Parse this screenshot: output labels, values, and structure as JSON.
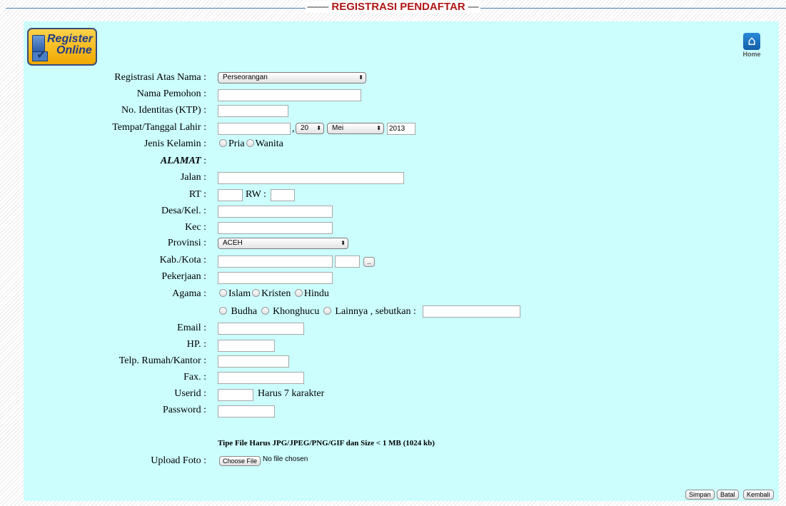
{
  "header": {
    "title": "REGISTRASI PENDAFTAR"
  },
  "logo": {
    "line1": "Register",
    "line2": "Online"
  },
  "home": {
    "label": "Home"
  },
  "labels": {
    "registrasi": "Registrasi Atas Nama :",
    "nama": "Nama Pemohon :",
    "identitas": "No. Identitas (KTP) :",
    "ttl": "Tempat/Tanggal Lahir :",
    "kelamin": "Jenis Kelamin :",
    "alamat": "ALAMAT",
    "alamat_colon": ":",
    "jalan": "Jalan :",
    "rt": "RT :",
    "rw": "RW :",
    "desa": "Desa/Kel. :",
    "kec": "Kec :",
    "provinsi": "Provinsi :",
    "kab": "Kab./Kota :",
    "pekerjaan": "Pekerjaan :",
    "agama": "Agama :",
    "email": "Email :",
    "hp": "HP. :",
    "telp": "Telp. Rumah/Kantor :",
    "fax": "Fax. :",
    "userid": "Userid :",
    "password": "Password :",
    "upload": "Upload Foto :"
  },
  "form": {
    "registrasi_value": "Perseorangan",
    "day_value": "20",
    "month_value": "Mei",
    "year_value": "2013",
    "comma": ",",
    "gender_options": [
      "Pria",
      "Wanita"
    ],
    "provinsi_value": "ACEH",
    "kab_button": "..",
    "agama_row1": [
      "Islam",
      "Kristen",
      "Hindu"
    ],
    "agama_row2": [
      "Budha",
      "Khonghucu"
    ],
    "agama_other": "Lainnya , sebutkan :",
    "userid_hint": "Harus 7 karakter",
    "file_note": "Tipe File Harus JPG/JPEG/PNG/GIF dan Size < 1 MB (1024 kb)",
    "choose_file": "Choose File",
    "no_file": "No file chosen"
  },
  "buttons": {
    "simpan": "Simpan",
    "batal": "Batal",
    "kembali": "Kembali"
  },
  "colors": {
    "panel": "#ccfefe",
    "title": "#b01616",
    "rule": "#4a7fb5"
  }
}
